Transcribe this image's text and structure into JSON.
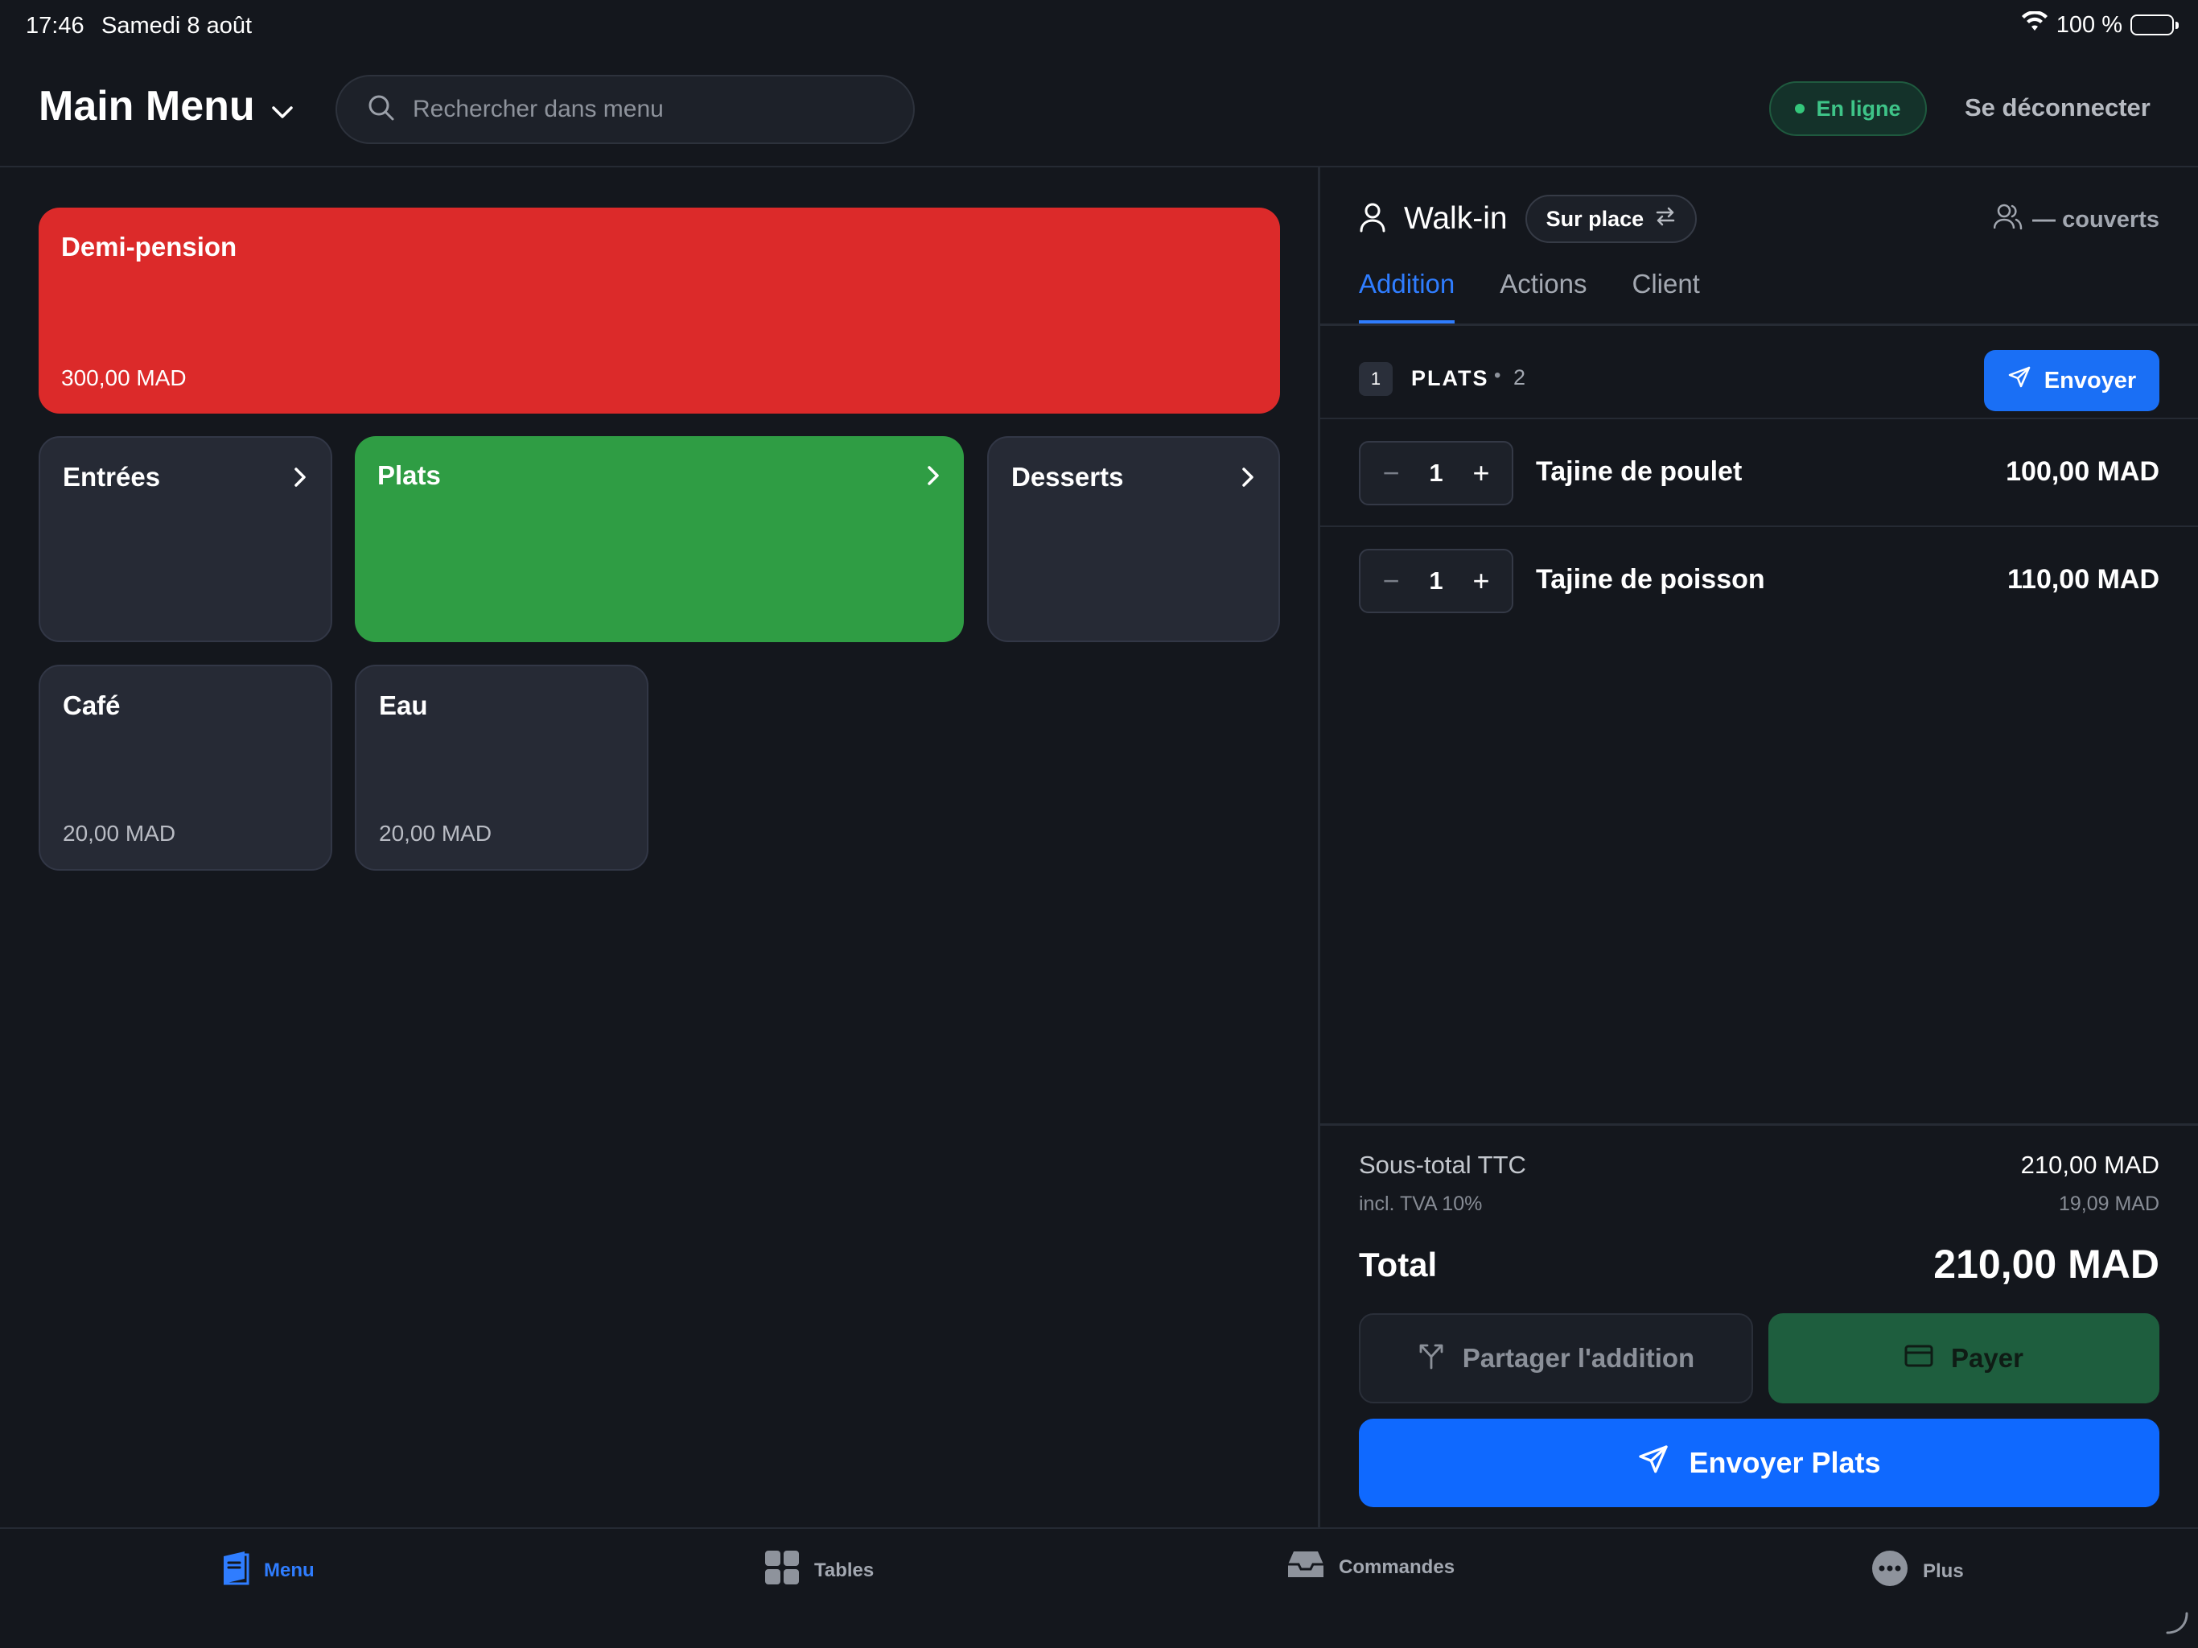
{
  "status_bar": {
    "time": "17:46",
    "date": "Samedi 8 août",
    "battery": "100 %"
  },
  "header": {
    "title": "Main Menu",
    "search_placeholder": "Rechercher dans menu",
    "status_label": "En ligne",
    "logout_label": "Se déconnecter"
  },
  "menu": {
    "featured": {
      "name": "Demi-pension",
      "price": "300,00 MAD",
      "color": "#dc2a2a"
    },
    "categories": [
      {
        "name": "Entrées"
      },
      {
        "name": "Plats",
        "color": "#2f9d44"
      },
      {
        "name": "Desserts"
      }
    ],
    "items": [
      {
        "name": "Café",
        "price": "20,00 MAD"
      },
      {
        "name": "Eau",
        "price": "20,00 MAD"
      }
    ]
  },
  "order": {
    "customer": "Walk-in",
    "service_mode": "Sur place",
    "covers": "— couverts",
    "tabs": [
      {
        "label": "Addition"
      },
      {
        "label": "Actions"
      },
      {
        "label": "Client"
      }
    ],
    "course": {
      "number": "1",
      "label": "PLATS",
      "separator": "•",
      "count": "2",
      "send_label": "Envoyer"
    },
    "lines": [
      {
        "qty": "1",
        "name": "Tajine de poulet",
        "price": "100,00 MAD"
      },
      {
        "qty": "1",
        "name": "Tajine de poisson",
        "price": "110,00 MAD"
      }
    ],
    "subtotal_label": "Sous-total TTC",
    "subtotal": "210,00 MAD",
    "tax_label": "incl. TVA 10%",
    "tax": "19,09 MAD",
    "total_label": "Total",
    "total": "210,00 MAD",
    "split_label": "Partager l'addition",
    "pay_label": "Payer",
    "send_course_label": "Envoyer Plats"
  },
  "tabbar": {
    "items": [
      {
        "label": "Menu",
        "icon": "menu-book-icon"
      },
      {
        "label": "Tables",
        "icon": "tables-grid-icon"
      },
      {
        "label": "Commandes",
        "icon": "tray-icon"
      },
      {
        "label": "Plus",
        "icon": "more-icon"
      }
    ]
  },
  "colors": {
    "accent": "#0f69ff",
    "online": "#3ec488",
    "background": "#14171d"
  }
}
